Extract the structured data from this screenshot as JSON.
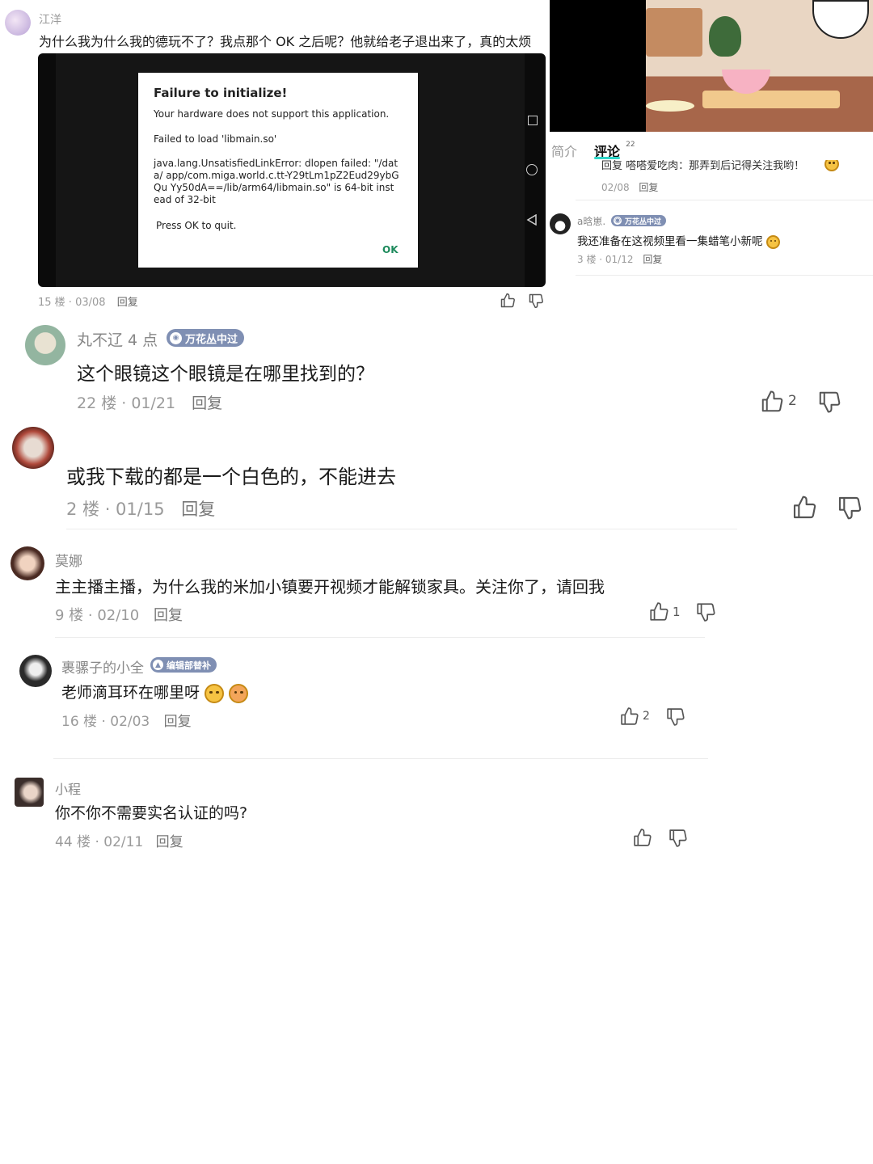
{
  "top_post": {
    "user": "江洋",
    "text": "为什么我为什么我的德玩不了？我点那个 OK 之后呢？他就给老子退出来了，真的太烦",
    "meta": "15 楼 · 03/08",
    "reply": "回复",
    "dialog": {
      "title": "Failure to initialize!",
      "line1": "Your hardware does not support this application.",
      "line2": "Failed to load 'libmain.so'",
      "line3": "java.lang.UnsatisfiedLinkError: dlopen failed: \"/data/ app/com.miga.world.c.tt-Y29tLm1pZ2Eud29ybGQu Yy50dA==/lib/arm64/libmain.so\" is 64-bit instead of 32-bit",
      "line4": "Press OK to quit.",
      "ok": "OK"
    },
    "nav_icons": [
      "square-icon",
      "circle-icon",
      "back-triangle-icon"
    ]
  },
  "video_panel": {
    "tabs": [
      {
        "label": "简介"
      },
      {
        "label": "评论",
        "count": "22"
      }
    ],
    "cut_reply": {
      "text": "回复 嗒嗒爱吃肉：那弄到后记得关注我哟！",
      "meta": "02/08",
      "reply": "回复"
    },
    "comment": {
      "user": "a晗崽.",
      "badge": "万花丛中过",
      "text": "我还准备在这视频里看一集蜡笔小新呢",
      "meta": "3 楼 · 01/12",
      "reply": "回复"
    }
  },
  "comments": [
    {
      "user": "丸不辽 4 点",
      "badge": "万花丛中过",
      "text": "这个眼镜这个眼镜是在哪里找到的？",
      "meta": "22 楼 · 01/21",
      "reply": "回复",
      "likes": "2"
    },
    {
      "user": "",
      "text": "或我下载的都是一个白色的，不能进去",
      "meta": "2 楼 · 01/15",
      "reply": "回复",
      "likes": ""
    },
    {
      "user": "莫娜",
      "text": "主主播主播，为什么我的米加小镇要开视频才能解锁家具。关注你了，请回我",
      "meta": "9 楼 · 02/10",
      "reply": "回复",
      "likes": "1"
    },
    {
      "user": "裹骡子的小全",
      "badge": "编辑部替补",
      "text": "老师滴耳环在哪里呀",
      "meta": "16 楼 · 02/03",
      "reply": "回复",
      "likes": "2"
    },
    {
      "user": "小程",
      "text": "你不你不需要实名认证的吗?",
      "meta": "44 楼 · 02/11",
      "reply": "回复",
      "likes": ""
    }
  ],
  "colors": {
    "badge": "#7f8fb3",
    "ok_green": "#1d8a5c",
    "tab_accent": "#2fd5c8",
    "meta_gray": "#9a9a9a"
  }
}
